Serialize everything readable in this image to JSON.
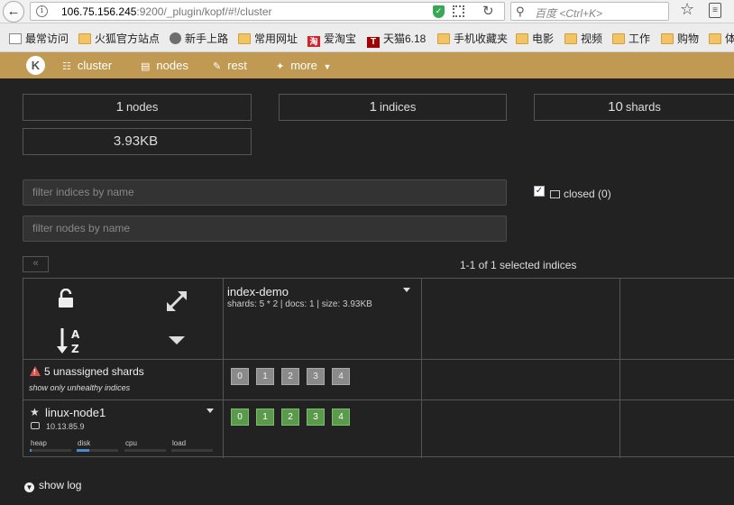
{
  "browser": {
    "url_host": "106.75.156.245",
    "url_rest": ":9200/_plugin/kopf/#!/cluster",
    "search_placeholder": "百度 <Ctrl+K>",
    "bookmarks": [
      {
        "label": "最常访问",
        "icon": "page"
      },
      {
        "label": "火狐官方站点",
        "icon": "folder"
      },
      {
        "label": "新手上路",
        "icon": "globe"
      },
      {
        "label": "常用网址",
        "icon": "folder"
      },
      {
        "label": "爱淘宝",
        "icon": "red"
      },
      {
        "label": "天猫6.18",
        "icon": "dark-red"
      },
      {
        "label": "手机收藏夹",
        "icon": "folder"
      },
      {
        "label": "电影",
        "icon": "folder"
      },
      {
        "label": "视频",
        "icon": "folder"
      },
      {
        "label": "工作",
        "icon": "folder"
      },
      {
        "label": "购物",
        "icon": "folder"
      },
      {
        "label": "体",
        "icon": "folder"
      }
    ]
  },
  "nav": {
    "logo": "K",
    "items": [
      {
        "label": "cluster",
        "icon": "sitemap-icon"
      },
      {
        "label": "nodes",
        "icon": "server-icon"
      },
      {
        "label": "rest",
        "icon": "edit-icon"
      },
      {
        "label": "more",
        "icon": "wand-icon"
      }
    ]
  },
  "stats": {
    "nodes_num": "1",
    "nodes_label": "nodes",
    "indices_num": "1",
    "indices_label": "indices",
    "shards_num": "10",
    "shards_label": "shards",
    "size": "3.93KB"
  },
  "filters": {
    "indices_placeholder": "filter indices by name",
    "nodes_placeholder": "filter nodes by name",
    "closed_label": "closed (0)",
    "closed_checked": true
  },
  "pagination": {
    "prev": "«",
    "info": "1-1 of 1 selected indices"
  },
  "index": {
    "name": "index-demo",
    "meta": "shards: 5 * 2 | docs: 1 | size: 3.93KB"
  },
  "unassigned": {
    "label": "5 unassigned shards",
    "link": "show only unhealthy indices",
    "shards": [
      "0",
      "1",
      "2",
      "3",
      "4"
    ]
  },
  "node": {
    "name": "linux-node1",
    "ip": "10.13.85.9",
    "shards": [
      "0",
      "1",
      "2",
      "3",
      "4"
    ],
    "metrics": [
      {
        "label": "heap",
        "value": 0.05
      },
      {
        "label": "disk",
        "value": 0.3
      },
      {
        "label": "cpu",
        "value": 0
      },
      {
        "label": "load",
        "value": 0
      }
    ]
  },
  "footer": {
    "show_log": "show log"
  },
  "colors": {
    "navbar": "#c09a52",
    "background": "#222222",
    "shard_assigned": "#5b9a4c",
    "shard_unassigned": "#8a8a8a",
    "warning": "#d9534f"
  }
}
